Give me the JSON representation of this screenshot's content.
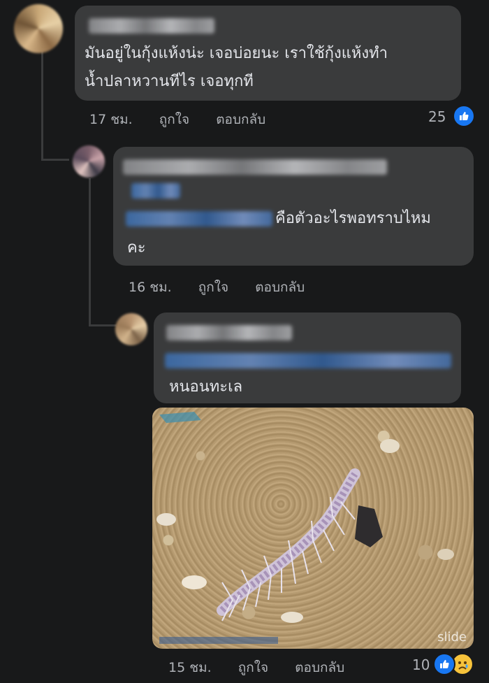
{
  "comments": [
    {
      "text_lines": [
        "มันอยู่ในกุ้งแห้งน่ะ เจอบ่อยนะ เราใช้กุ้งแห้งทำ",
        "น้ำปลาหวานทีไร เจอทุกที"
      ],
      "time": "17 ชม.",
      "like_label": "ถูกใจ",
      "reply_label": "ตอบกลับ",
      "reaction_count": "25"
    },
    {
      "text_lines": [
        "คือตัวอะไรพอทราบไหม",
        "คะ"
      ],
      "time": "16 ชม.",
      "like_label": "ถูกใจ",
      "reply_label": "ตอบกลับ"
    },
    {
      "text_lines": [
        "หนอนทะเล"
      ],
      "time": "15 ชม.",
      "like_label": "ถูกใจ",
      "reply_label": "ตอบกลับ",
      "reaction_count": "10",
      "photo_watermark": "slide"
    }
  ],
  "colors": {
    "background": "#18191a",
    "bubble": "#3a3b3c",
    "text": "#e4e6eb",
    "meta": "#b0b3b8",
    "like_blue": "#1877f2",
    "sad_yellow": "#f7c33b"
  },
  "icons": {
    "like": "thumbs-up-icon",
    "sad": "sad-face-icon"
  }
}
